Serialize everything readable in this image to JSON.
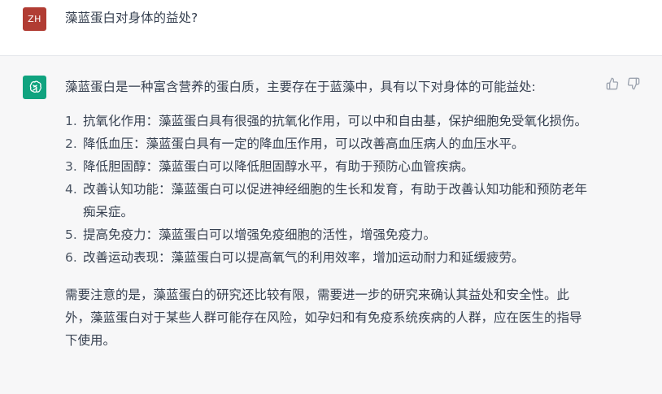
{
  "user_message": {
    "avatar_initials": "ZH",
    "text": "藻蓝蛋白对身体的益处?"
  },
  "assistant_message": {
    "intro": "藻蓝蛋白是一种富含营养的蛋白质，主要存在于蓝藻中，具有以下对身体的可能益处:",
    "items": [
      {
        "num": "1.",
        "text": "抗氧化作用：藻蓝蛋白具有很强的抗氧化作用，可以中和自由基，保护细胞免受氧化损伤。"
      },
      {
        "num": "2.",
        "text": "降低血压：藻蓝蛋白具有一定的降血压作用，可以改善高血压病人的血压水平。"
      },
      {
        "num": "3.",
        "text": "降低胆固醇：藻蓝蛋白可以降低胆固醇水平，有助于预防心血管疾病。"
      },
      {
        "num": "4.",
        "text": "改善认知功能：藻蓝蛋白可以促进神经细胞的生长和发育，有助于改善认知功能和预防老年痴呆症。"
      },
      {
        "num": "5.",
        "text": "提高免疫力：藻蓝蛋白可以增强免疫细胞的活性，增强免疫力。"
      },
      {
        "num": "6.",
        "text": "改善运动表现：藻蓝蛋白可以提高氧气的利用效率，增加运动耐力和延缓疲劳。"
      }
    ],
    "note": "需要注意的是，藻蓝蛋白的研究还比较有限，需要进一步的研究来确认其益处和安全性。此外，藻蓝蛋白对于某些人群可能存在风险，如孕妇和有免疫系统疾病的人群，应在医生的指导下使用。"
  },
  "colors": {
    "user_avatar": "#b13c33",
    "bot_avatar": "#10a37f",
    "bot_background": "#f7f7f8",
    "text": "#374151"
  },
  "icons": [
    "openai-logo-icon",
    "thumbs-up-icon",
    "thumbs-down-icon"
  ]
}
